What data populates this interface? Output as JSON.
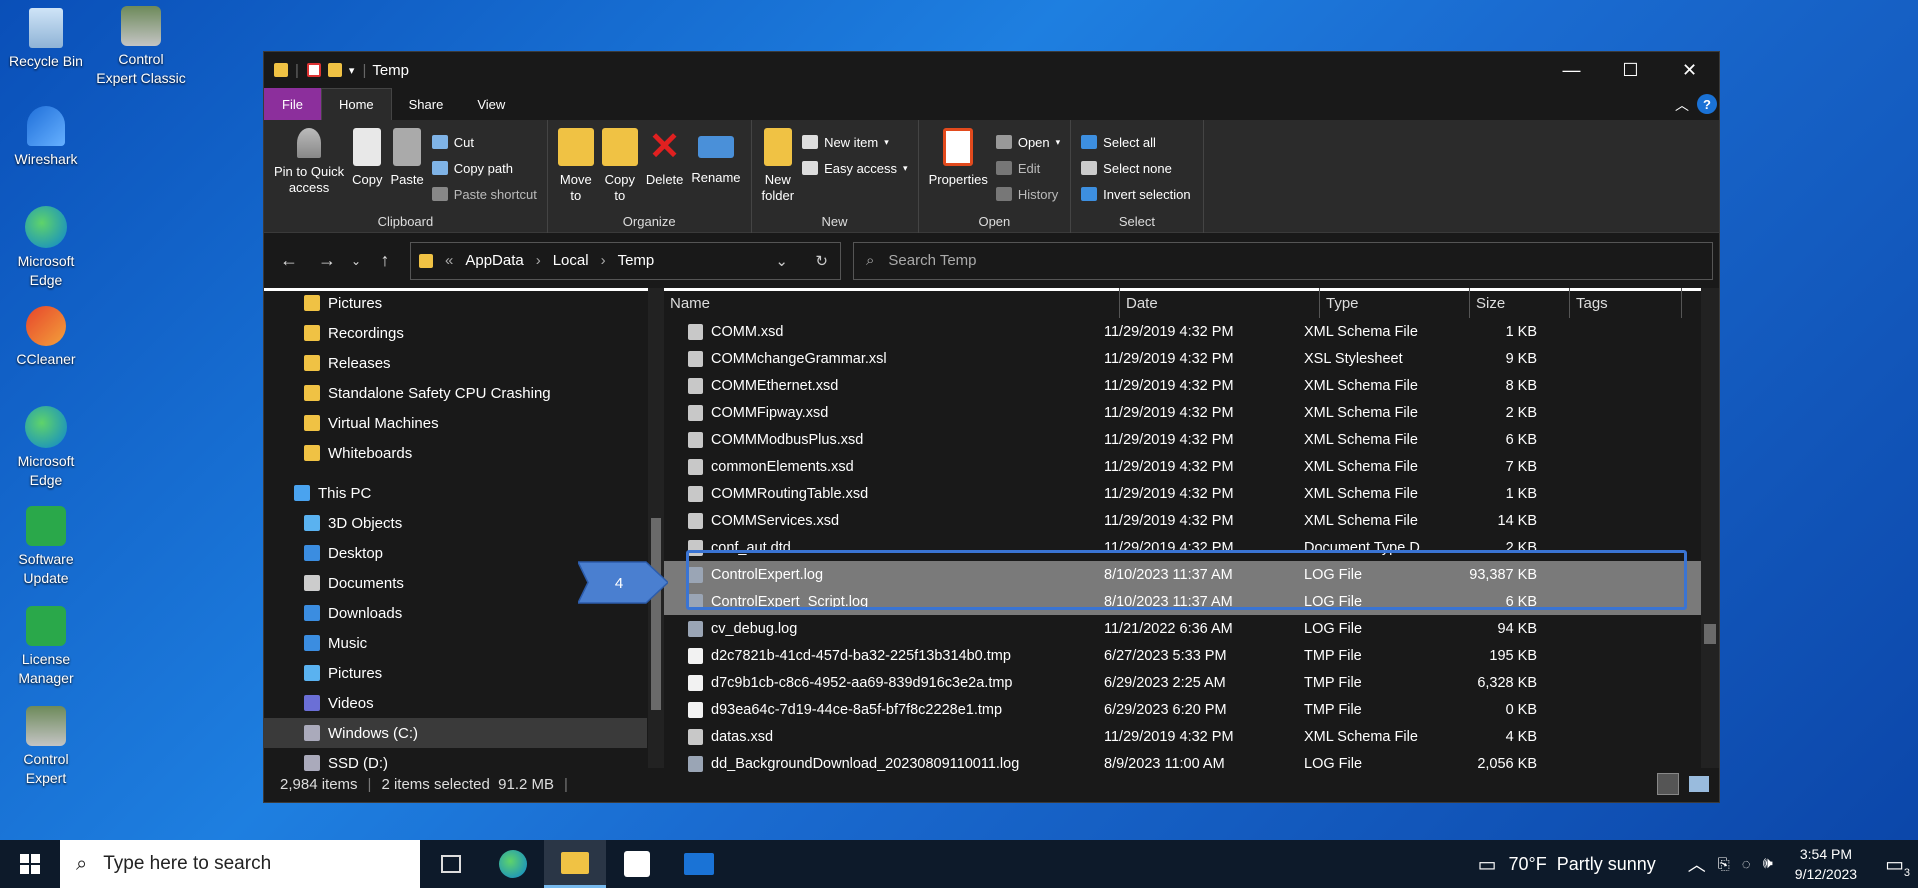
{
  "desktop": {
    "icons": [
      {
        "label": "Recycle Bin"
      },
      {
        "label": "Control\nExpert Classic"
      },
      {
        "label": "Wireshark"
      },
      {
        "label": "Microsoft\nEdge"
      },
      {
        "label": "CCleaner"
      },
      {
        "label": "Microsoft\nEdge"
      },
      {
        "label": "Software\nUpdate"
      },
      {
        "label": "License\nManager"
      },
      {
        "label": "Control\nExpert"
      }
    ]
  },
  "window": {
    "title": "Temp",
    "tabs": [
      "File",
      "Home",
      "Share",
      "View"
    ],
    "help": "?"
  },
  "ribbon": {
    "clipboard": {
      "pin": "Pin to Quick\naccess",
      "copy": "Copy",
      "paste": "Paste",
      "cut": "Cut",
      "copy_path": "Copy path",
      "paste_shortcut": "Paste shortcut",
      "label": "Clipboard"
    },
    "organize": {
      "move_to": "Move\nto",
      "copy_to": "Copy\nto",
      "delete": "Delete",
      "rename": "Rename",
      "label": "Organize"
    },
    "new": {
      "new_folder": "New\nfolder",
      "new_item": "New item",
      "easy_access": "Easy access",
      "label": "New"
    },
    "open": {
      "properties": "Properties",
      "open": "Open",
      "edit": "Edit",
      "history": "History",
      "label": "Open"
    },
    "select": {
      "select_all": "Select all",
      "select_none": "Select none",
      "invert": "Invert selection",
      "label": "Select"
    }
  },
  "address": {
    "crumbs": [
      "«",
      "AppData",
      "Local",
      "Temp"
    ],
    "search_placeholder": "Search Temp"
  },
  "nav_pane": {
    "items": [
      {
        "label": "Pictures"
      },
      {
        "label": "Recordings"
      },
      {
        "label": "Releases"
      },
      {
        "label": "Standalone Safety CPU Crashing"
      },
      {
        "label": "Virtual Machines"
      },
      {
        "label": "Whiteboards"
      },
      {
        "label": "This PC"
      },
      {
        "label": "3D Objects"
      },
      {
        "label": "Desktop"
      },
      {
        "label": "Documents"
      },
      {
        "label": "Downloads"
      },
      {
        "label": "Music"
      },
      {
        "label": "Pictures"
      },
      {
        "label": "Videos"
      },
      {
        "label": "Windows (C:)"
      },
      {
        "label": "SSD (D:)"
      }
    ]
  },
  "columns": [
    "Name",
    "Date",
    "Type",
    "Size",
    "Tags"
  ],
  "files": [
    {
      "name": "COMM.xsd",
      "date": "11/29/2019 4:32 PM",
      "type": "XML Schema File",
      "size": "1 KB"
    },
    {
      "name": "COMMchangeGrammar.xsl",
      "date": "11/29/2019 4:32 PM",
      "type": "XSL Stylesheet",
      "size": "9 KB"
    },
    {
      "name": "COMMEthernet.xsd",
      "date": "11/29/2019 4:32 PM",
      "type": "XML Schema File",
      "size": "8 KB"
    },
    {
      "name": "COMMFipway.xsd",
      "date": "11/29/2019 4:32 PM",
      "type": "XML Schema File",
      "size": "2 KB"
    },
    {
      "name": "COMMModbusPlus.xsd",
      "date": "11/29/2019 4:32 PM",
      "type": "XML Schema File",
      "size": "6 KB"
    },
    {
      "name": "commonElements.xsd",
      "date": "11/29/2019 4:32 PM",
      "type": "XML Schema File",
      "size": "7 KB"
    },
    {
      "name": "COMMRoutingTable.xsd",
      "date": "11/29/2019 4:32 PM",
      "type": "XML Schema File",
      "size": "1 KB"
    },
    {
      "name": "COMMServices.xsd",
      "date": "11/29/2019 4:32 PM",
      "type": "XML Schema File",
      "size": "14 KB"
    },
    {
      "name": "conf_aut.dtd",
      "date": "11/29/2019 4:32 PM",
      "type": "Document Type D...",
      "size": "2 KB"
    },
    {
      "name": "ControlExpert.log",
      "date": "8/10/2023 11:37 AM",
      "type": "LOG File",
      "size": "93,387 KB"
    },
    {
      "name": "ControlExpert_Script.log",
      "date": "8/10/2023 11:37 AM",
      "type": "LOG File",
      "size": "6 KB"
    },
    {
      "name": "cv_debug.log",
      "date": "11/21/2022 6:36 AM",
      "type": "LOG File",
      "size": "94 KB"
    },
    {
      "name": "d2c7821b-41cd-457d-ba32-225f13b314b0.tmp",
      "date": "6/27/2023 5:33 PM",
      "type": "TMP File",
      "size": "195 KB"
    },
    {
      "name": "d7c9b1cb-c8c6-4952-aa69-839d916c3e2a.tmp",
      "date": "6/29/2023 2:25 AM",
      "type": "TMP File",
      "size": "6,328 KB"
    },
    {
      "name": "d93ea64c-7d19-44ce-8a5f-bf7f8c2228e1.tmp",
      "date": "6/29/2023 6:20 PM",
      "type": "TMP File",
      "size": "0 KB"
    },
    {
      "name": "datas.xsd",
      "date": "11/29/2019 4:32 PM",
      "type": "XML Schema File",
      "size": "4 KB"
    },
    {
      "name": "dd_BackgroundDownload_20230809110011.log",
      "date": "8/9/2023 11:00 AM",
      "type": "LOG File",
      "size": "2,056 KB"
    }
  ],
  "status": {
    "count": "2,984 items",
    "selected": "2 items selected  91.2 MB"
  },
  "callout": {
    "label": "4"
  },
  "taskbar": {
    "search_placeholder": "Type here to search",
    "weather": "70°F  Partly sunny",
    "time": "3:54 PM",
    "date": "9/12/2023",
    "notification_count": "3"
  }
}
